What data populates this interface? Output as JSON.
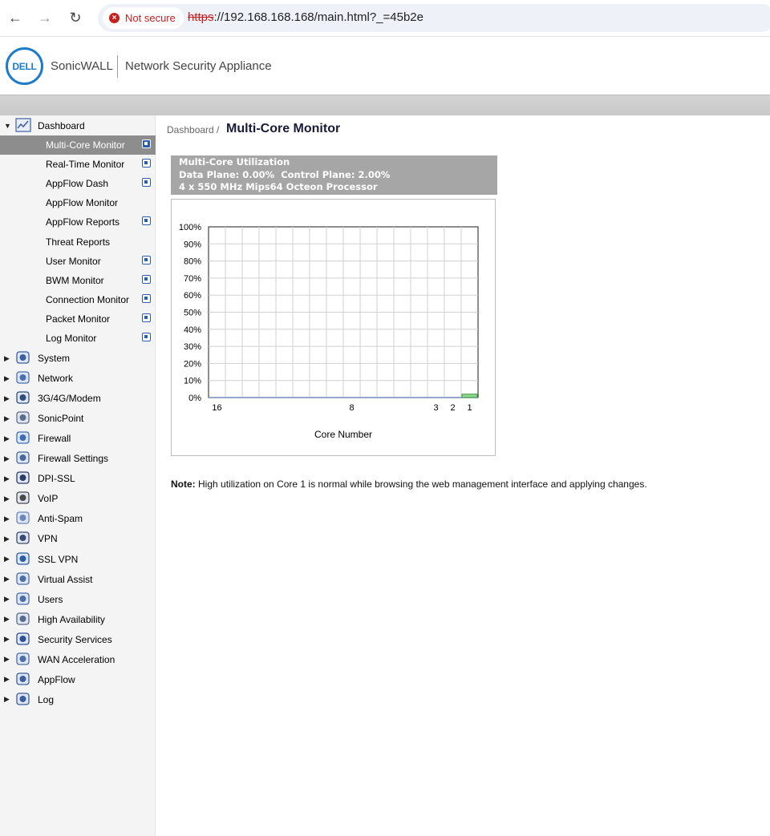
{
  "browser": {
    "security_label": "Not secure",
    "url_scheme": "https",
    "url_rest": "://192.168.168.168/main.html?_=45b2e",
    "back_icon": "←",
    "forward_icon": "→",
    "reload_icon": "↻"
  },
  "header": {
    "logo_text": "DELL",
    "brand": "SonicWALL",
    "product": "Network Security Appliance"
  },
  "sidebar": {
    "dashboard_label": "Dashboard",
    "sub_items": [
      {
        "label": "Multi-Core Monitor",
        "external": true,
        "active": true
      },
      {
        "label": "Real-Time Monitor",
        "external": true
      },
      {
        "label": "AppFlow Dash",
        "external": true
      },
      {
        "label": "AppFlow Monitor",
        "external": false
      },
      {
        "label": "AppFlow Reports",
        "external": true
      },
      {
        "label": "Threat Reports",
        "external": false
      },
      {
        "label": "User Monitor",
        "external": true
      },
      {
        "label": "BWM Monitor",
        "external": true
      },
      {
        "label": "Connection Monitor",
        "external": true
      },
      {
        "label": "Packet Monitor",
        "external": true
      },
      {
        "label": "Log Monitor",
        "external": true
      }
    ],
    "top_items": [
      {
        "label": "System",
        "icon": "monitor-icon"
      },
      {
        "label": "Network",
        "icon": "globe-icon"
      },
      {
        "label": "3G/4G/Modem",
        "icon": "modem-icon"
      },
      {
        "label": "SonicPoint",
        "icon": "access-point-icon"
      },
      {
        "label": "Firewall",
        "icon": "firewall-icon"
      },
      {
        "label": "Firewall Settings",
        "icon": "firewall-settings-icon"
      },
      {
        "label": "DPI-SSL",
        "icon": "dpi-lock-icon"
      },
      {
        "label": "VoIP",
        "icon": "headset-icon"
      },
      {
        "label": "Anti-Spam",
        "icon": "mail-icon"
      },
      {
        "label": "VPN",
        "icon": "vpn-lock-icon"
      },
      {
        "label": "SSL VPN",
        "icon": "ssl-vpn-icon"
      },
      {
        "label": "Virtual Assist",
        "icon": "assist-user-icon"
      },
      {
        "label": "Users",
        "icon": "users-icon"
      },
      {
        "label": "High Availability",
        "icon": "ha-server-icon"
      },
      {
        "label": "Security Services",
        "icon": "shield-icon"
      },
      {
        "label": "WAN Acceleration",
        "icon": "wan-doc-icon"
      },
      {
        "label": "AppFlow",
        "icon": "appflow-chart-icon"
      },
      {
        "label": "Log",
        "icon": "log-search-icon"
      }
    ]
  },
  "main": {
    "breadcrumb": "Dashboard /",
    "title": "Multi-Core Monitor",
    "panel": {
      "line1": "Multi-Core Utilization",
      "line2": "Data Plane: 0.00%  Control Plane: 2.00%",
      "line3": "4 x 550 MHz Mips64 Octeon Processor"
    },
    "note_bold": "Note:",
    "note_text": " High utilization on Core 1 is normal while browsing the web management interface and applying changes."
  },
  "chart_data": {
    "type": "bar",
    "xlabel": "Core Number",
    "ylabel": "",
    "ylim": [
      0,
      100
    ],
    "y_ticks": [
      "100%",
      "90%",
      "80%",
      "70%",
      "60%",
      "50%",
      "40%",
      "30%",
      "20%",
      "10%",
      "0%"
    ],
    "x_tick_labels": [
      {
        "core": 16,
        "label": "16"
      },
      {
        "core": 8,
        "label": "8"
      },
      {
        "core": 3,
        "label": "3"
      },
      {
        "core": 2,
        "label": "2"
      },
      {
        "core": 1,
        "label": "1"
      }
    ],
    "cores": [
      16,
      15,
      14,
      13,
      12,
      11,
      10,
      9,
      8,
      7,
      6,
      5,
      4,
      3,
      2,
      1
    ],
    "values": [
      0,
      0,
      0,
      0,
      0,
      0,
      0,
      0,
      0,
      0,
      0,
      0,
      0,
      0,
      0,
      2
    ],
    "bar_color": "#8fd48f",
    "bar_border": "#3a9a3a",
    "grid": true
  }
}
